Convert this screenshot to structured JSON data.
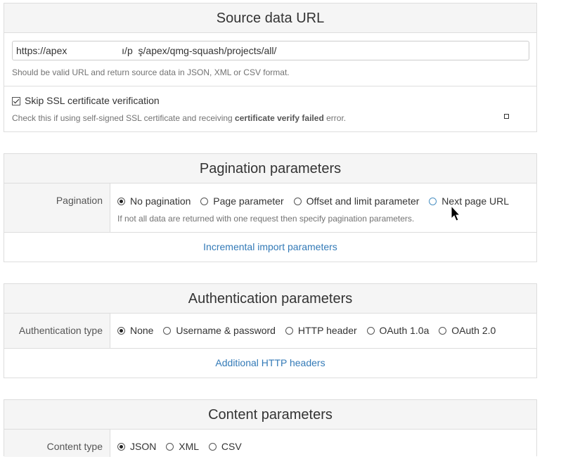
{
  "source": {
    "title": "Source data URL",
    "url_value": "https://apex                    ı/p  ş/apex/qmg-squash/projects/all/",
    "url_help": "Should be valid URL and return source data in JSON, XML or CSV format.",
    "ssl_label": "Skip SSL certificate verification",
    "ssl_checked": true,
    "ssl_help_prefix": "Check this if using self-signed SSL certificate and receiving ",
    "ssl_help_bold": "certificate verify failed",
    "ssl_help_suffix": " error."
  },
  "pagination": {
    "title": "Pagination parameters",
    "label": "Pagination",
    "options": [
      "No pagination",
      "Page parameter",
      "Offset and limit parameter",
      "Next page URL"
    ],
    "selected": "No pagination",
    "help": "If not all data are returned with one request then specify pagination parameters.",
    "incremental_link": "Incremental import parameters"
  },
  "authentication": {
    "title": "Authentication parameters",
    "label": "Authentication type",
    "options": [
      "None",
      "Username & password",
      "HTTP header",
      "OAuth 1.0a",
      "OAuth 2.0"
    ],
    "selected": "None",
    "headers_link": "Additional HTTP headers"
  },
  "content": {
    "title": "Content parameters",
    "label": "Content type",
    "options": [
      "JSON",
      "XML",
      "CSV"
    ],
    "selected": "JSON"
  },
  "colors": {
    "link": "#337ab7",
    "panel_header_bg": "#f5f5f5",
    "border": "#dddddd"
  }
}
